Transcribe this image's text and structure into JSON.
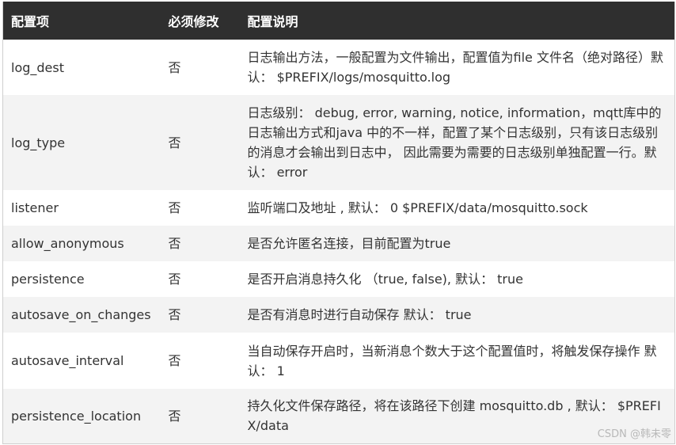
{
  "table": {
    "headers": [
      "配置项",
      "必须修改",
      "配置说明"
    ],
    "rows": [
      {
        "item": "log_dest",
        "required": "否",
        "desc": "日志输出方法，一般配置为文件输出，配置值为file 文件名（绝对路径）默认：  $PREFIX/logs/mosquitto.log"
      },
      {
        "item": "log_type",
        "required": "否",
        "desc": "日志级别：  debug, error, warning, notice, information，mqtt库中的日志输出方式和java 中的不一样，配置了某个日志级别，只有该日志级别的消息才会输出到日志中， 因此需要为需要的日志级别单独配置一行。默认：  error"
      },
      {
        "item": "listener",
        "required": "否",
        "desc": "监听端口及地址 , 默认：  0 $PREFIX/data/mosquitto.sock"
      },
      {
        "item": "allow_anonymous",
        "required": "否",
        "desc": "是否允许匿名连接，目前配置为true"
      },
      {
        "item": "persistence",
        "required": "否",
        "desc": "是否开启消息持久化 （true, false), 默认：  true"
      },
      {
        "item": "autosave_on_changes",
        "required": "否",
        "desc": "是否有消息时进行自动保存 默认：  true"
      },
      {
        "item": "autosave_interval",
        "required": "否",
        "desc": "当自动保存开启时，当新消息个数大于这个配置值时，将触发保存操作 默认：  1"
      },
      {
        "item": "persistence_location",
        "required": "否",
        "desc": "持久化文件保存路径，将在该路径下创建 mosquitto.db , 默认：  $PREFIX/data"
      }
    ]
  },
  "watermark": "CSDN @韩未零"
}
